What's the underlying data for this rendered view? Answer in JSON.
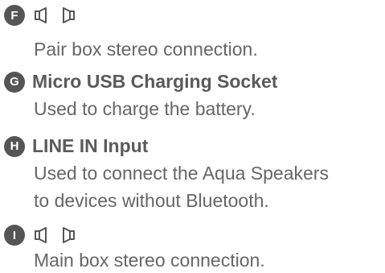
{
  "items": [
    {
      "badge": "F",
      "title": "",
      "icons": [
        "speaker-icon",
        "speaker-icon"
      ],
      "description_lines": [
        "Pair box stereo connection."
      ]
    },
    {
      "badge": "G",
      "title": "Micro USB Charging Socket",
      "icons": [],
      "description_lines": [
        "Used to charge the battery."
      ]
    },
    {
      "badge": "H",
      "title": "LINE IN Input",
      "icons": [],
      "description_lines": [
        "Used to connect the Aqua Speakers",
        "to devices without Bluetooth."
      ]
    },
    {
      "badge": "I",
      "title": "",
      "icons": [
        "speaker-icon",
        "speaker-icon"
      ],
      "description_lines": [
        "Main box stereo connection."
      ]
    }
  ],
  "colors": {
    "badge_bg": "#555555",
    "badge_text": "#ffffff",
    "text": "#666666"
  }
}
